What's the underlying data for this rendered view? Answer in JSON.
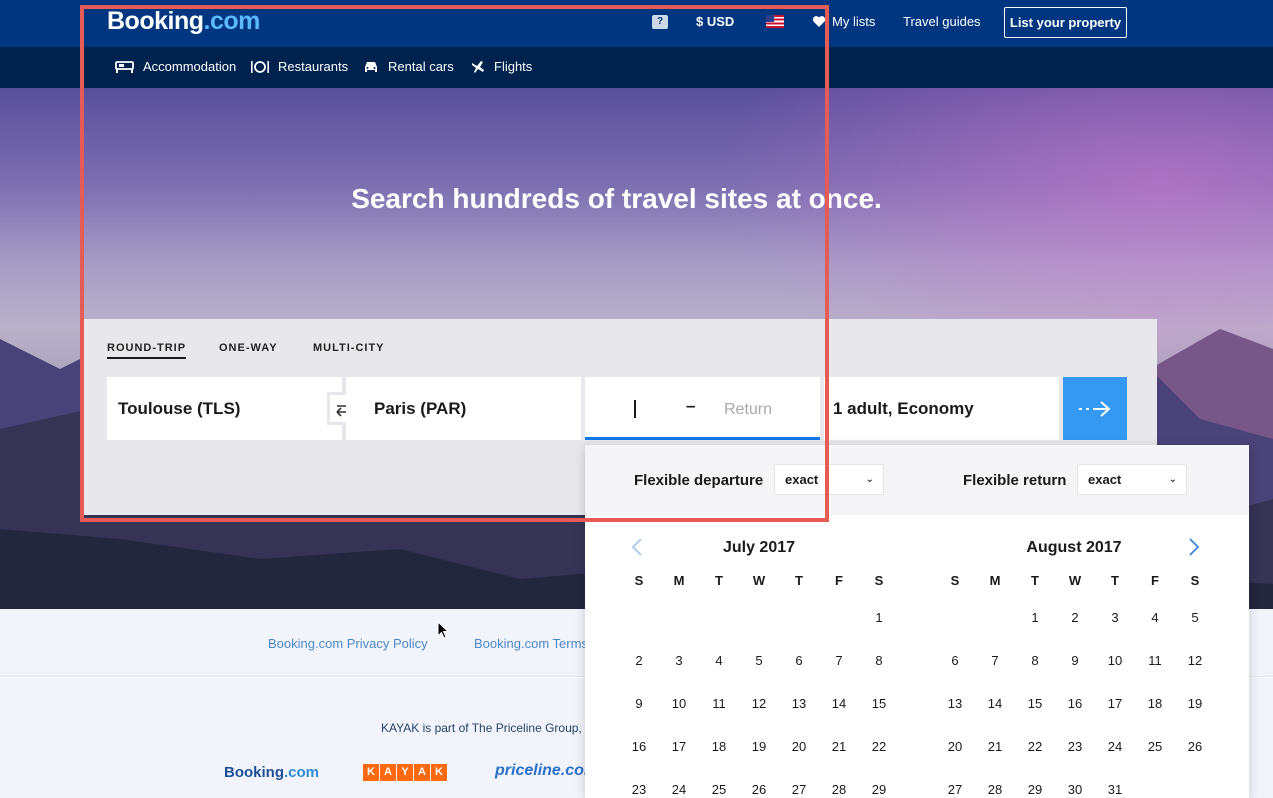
{
  "header": {
    "logo_main": "Booking",
    "logo_suffix": ".com",
    "currency": "$  USD",
    "my_lists": "My lists",
    "travel_guides": "Travel guides",
    "list_property": "List your property"
  },
  "nav": {
    "accommodation": "Accommodation",
    "restaurants": "Restaurants",
    "rental_cars": "Rental cars",
    "flights": "Flights"
  },
  "hero": {
    "title": "Search hundreds of travel sites at once."
  },
  "search": {
    "tabs": [
      "ROUND-TRIP",
      "ONE-WAY",
      "MULTI-CITY"
    ],
    "origin": "Toulouse (TLS)",
    "destination": "Paris (PAR)",
    "date_separator": "–",
    "return_placeholder": "Return",
    "travelers": "1 adult, Economy"
  },
  "datepicker": {
    "flexible_departure_label": "Flexible departure",
    "flexible_departure_value": "exact",
    "flexible_return_label": "Flexible return",
    "flexible_return_value": "exact",
    "weekdays": [
      "S",
      "M",
      "T",
      "W",
      "T",
      "F",
      "S"
    ],
    "months": [
      {
        "title": "July 2017",
        "weeks": [
          [
            "",
            "",
            "",
            "",
            "",
            "",
            "1"
          ],
          [
            "2",
            "3",
            "4",
            "5",
            "6",
            "7",
            "8"
          ],
          [
            "9",
            "10",
            "11",
            "12",
            "13",
            "14",
            "15"
          ],
          [
            "16",
            "17",
            "18",
            "19",
            "20",
            "21",
            "22"
          ],
          [
            "23",
            "24",
            "25",
            "26",
            "27",
            "28",
            "29"
          ]
        ]
      },
      {
        "title": "August 2017",
        "weeks": [
          [
            "",
            "",
            "1",
            "2",
            "3",
            "4",
            "5"
          ],
          [
            "6",
            "7",
            "8",
            "9",
            "10",
            "11",
            "12"
          ],
          [
            "13",
            "14",
            "15",
            "16",
            "17",
            "18",
            "19"
          ],
          [
            "20",
            "21",
            "22",
            "23",
            "24",
            "25",
            "26"
          ],
          [
            "27",
            "28",
            "29",
            "30",
            "31",
            "",
            ""
          ]
        ]
      }
    ]
  },
  "footer": {
    "privacy_policy": "Booking.com Privacy Policy",
    "terms": "Booking.com Terms",
    "kayak_line": "KAYAK is part of The Priceline Group,",
    "logo_booking": "Booking",
    "logo_booking_suffix": ".com",
    "logo_kayak": [
      "K",
      "A",
      "Y",
      "A",
      "K"
    ],
    "logo_priceline": "priceline.com"
  },
  "colors": {
    "header_blue": "#003580",
    "nav_navy": "#00224f",
    "accent_blue": "#3399f3",
    "annotation_red": "#e55b55"
  }
}
